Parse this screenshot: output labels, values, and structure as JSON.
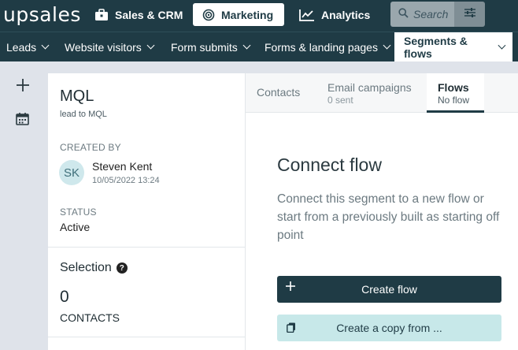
{
  "app": {
    "logo_text": "upsales",
    "top_nav": [
      {
        "label": "Sales & CRM",
        "icon": "briefcase-icon"
      },
      {
        "label": "Marketing",
        "icon": "target-icon",
        "active": true
      },
      {
        "label": "Analytics",
        "icon": "line-chart-icon"
      }
    ],
    "search_placeholder": "Search",
    "colors": {
      "navbar": "#1f3b45",
      "accent_light": "#c7e8e9",
      "background": "#dfe3ea"
    }
  },
  "sub_nav": [
    {
      "label": "Leads"
    },
    {
      "label": "Website visitors"
    },
    {
      "label": "Form submits"
    },
    {
      "label": "Forms & landing pages"
    },
    {
      "label": "Segments & flows",
      "active": true
    }
  ],
  "segment": {
    "title": "MQL",
    "subtitle": "lead to MQL",
    "created_by_label": "CREATED BY",
    "creator_initials": "SK",
    "creator_name": "Steven Kent",
    "created_at": "10/05/2022 13:24",
    "status_label": "STATUS",
    "status": "Active",
    "selection_label": "Selection",
    "contact_count": "0",
    "contacts_label": "CONTACTS"
  },
  "tabs": [
    {
      "label": "Contacts",
      "sub": ""
    },
    {
      "label": "Email campaigns",
      "sub": "0 sent"
    },
    {
      "label": "Flows",
      "sub": "No flow",
      "active": true
    }
  ],
  "flow": {
    "heading": "Connect flow",
    "description": "Connect this segment to a new flow or start from a previously built as starting off point",
    "create_label": "Create flow",
    "copy_label": "Create a copy from ..."
  }
}
